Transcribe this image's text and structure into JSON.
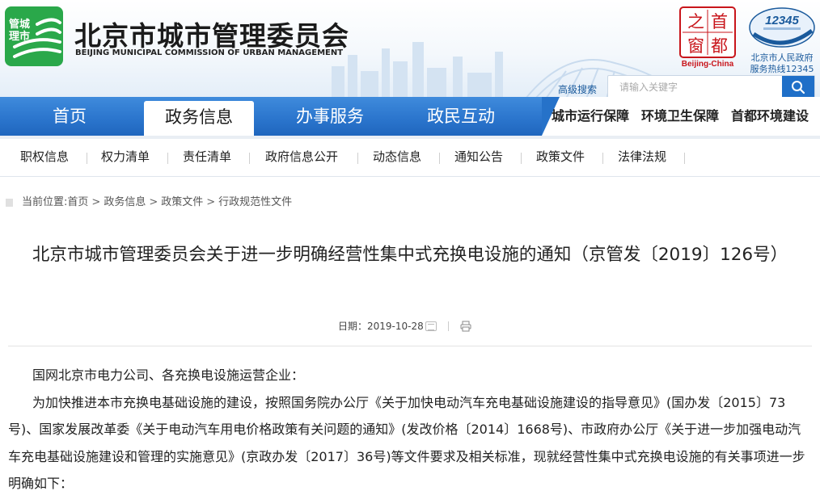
{
  "header": {
    "badge_line1": "管城",
    "badge_line2": "理市",
    "title": "北京市城市管理委员会",
    "subtitle": "BEIJING MUNICIPAL COMMISSION OF URBAN MANAGEMENT",
    "bj_logo_chars": [
      "首",
      "都",
      "之",
      "窗"
    ],
    "bj_logo_name": "Beijing-China",
    "hotline_number": "12345",
    "hotline_line1": "北京市人民政府",
    "hotline_line2": "服务热线12345",
    "advanced_search": "高级搜索",
    "search_placeholder": "请输入关键字"
  },
  "nav": {
    "items": [
      "首页",
      "政务信息",
      "办事服务",
      "政民互动"
    ],
    "active_index": 1,
    "right_links": [
      "城市运行保障",
      "环境卫生保障",
      "首都环境建设"
    ]
  },
  "subnav": {
    "items": [
      "职权信息",
      "权力清单",
      "责任清单",
      "政府信息公开",
      "动态信息",
      "通知公告",
      "政策文件",
      "法律法规"
    ]
  },
  "breadcrumb": {
    "prefix": "当前位置:",
    "items": [
      "首页",
      "政务信息",
      "政策文件",
      "行政规范性文件"
    ],
    "separator": ">"
  },
  "article": {
    "title": "北京市城市管理委员会关于进一步明确经营性集中式充换电设施的通知（京管发〔2019〕126号）",
    "date_label": "日期：",
    "date": "2019-10-28",
    "salutation": "国网北京市电力公司、各充换电设施运营企业：",
    "paragraph1": "为加快推进本市充换电基础设施的建设，按照国务院办公厅《关于加快电动汽车充电基础设施建设的指导意见》(国办发〔2015〕73号)、国家发展改革委《关于电动汽车用电价格政策有关问题的通知》(发改价格〔2014〕1668号)、市政府办公厅《关于进一步加强电动汽车充电基础设施建设和管理的实施意见》(京政办发〔2017〕36号)等文件要求及相关标准，现就经营性集中式充换电设施的有关事项进一步明确如下："
  },
  "colors": {
    "nav_blue": "#2a74cc",
    "badge_green": "#2aa84a",
    "brand_red": "#c8151b",
    "search_button": "#1f6fc8"
  }
}
